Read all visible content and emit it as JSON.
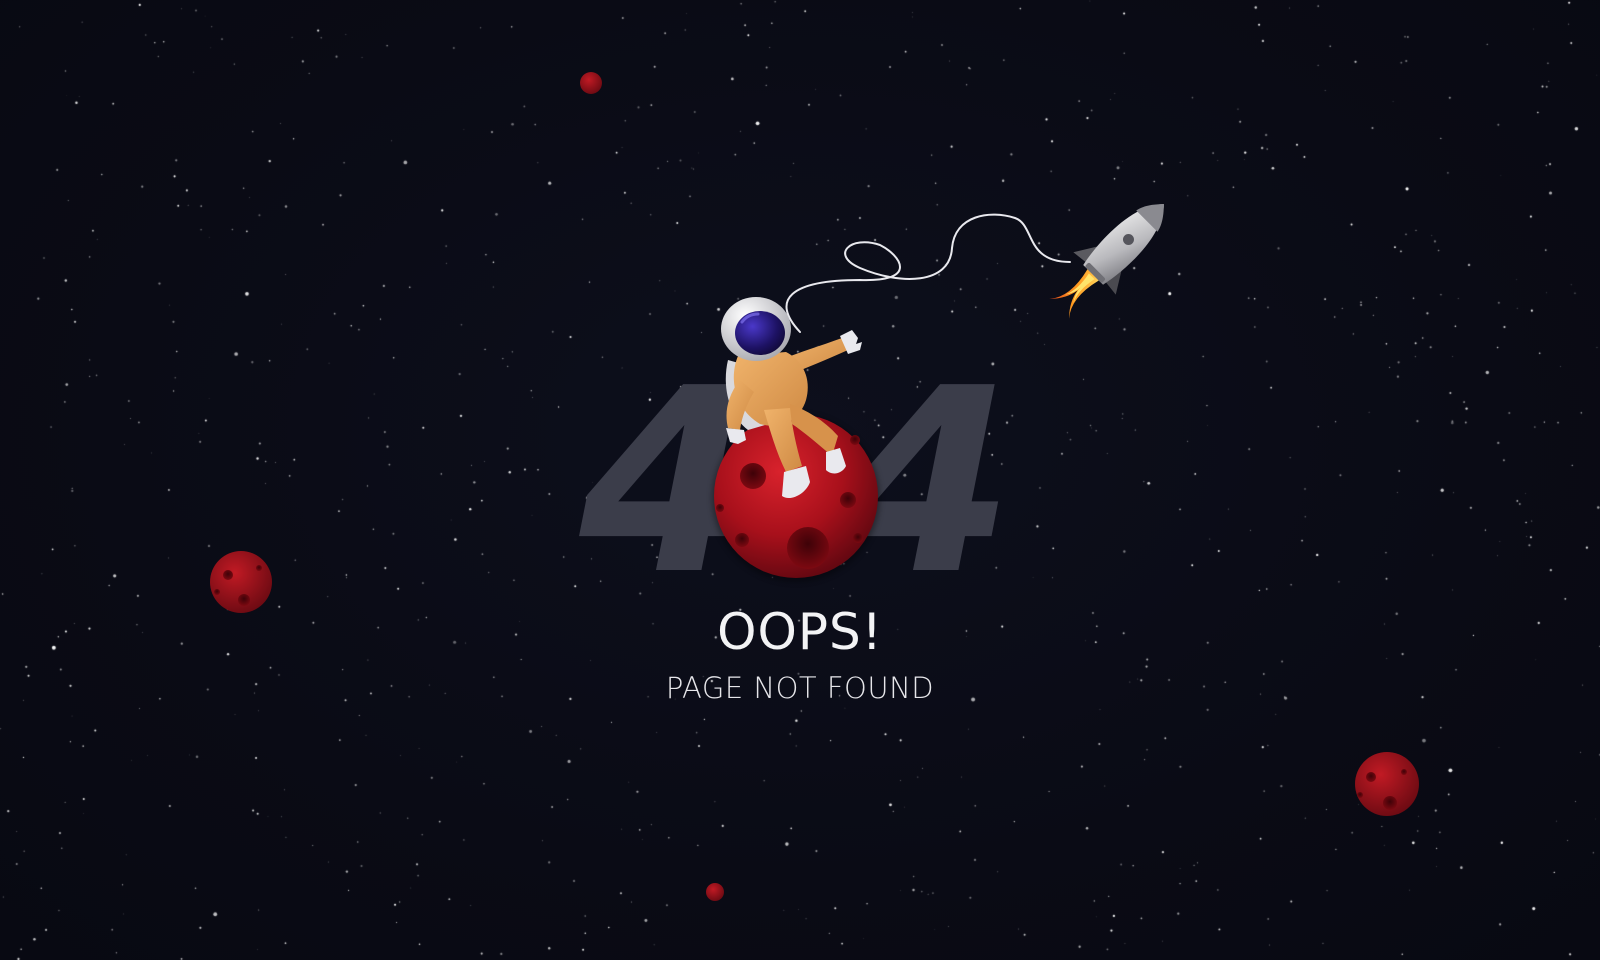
{
  "error": {
    "code_left": "4",
    "code_right": "4",
    "title": "OOPS!",
    "message": "PAGE NOT FOUND"
  },
  "colors": {
    "background": "#0a0b15",
    "digits": "#3b3d4a",
    "planet": "#a5101a",
    "suit": "#e8a055",
    "visor": "#2a1b7a",
    "text": "#f3f3f5"
  },
  "icons": [
    "astronaut-icon",
    "rocket-icon",
    "planet-icon",
    "tether-icon",
    "star-icon"
  ]
}
